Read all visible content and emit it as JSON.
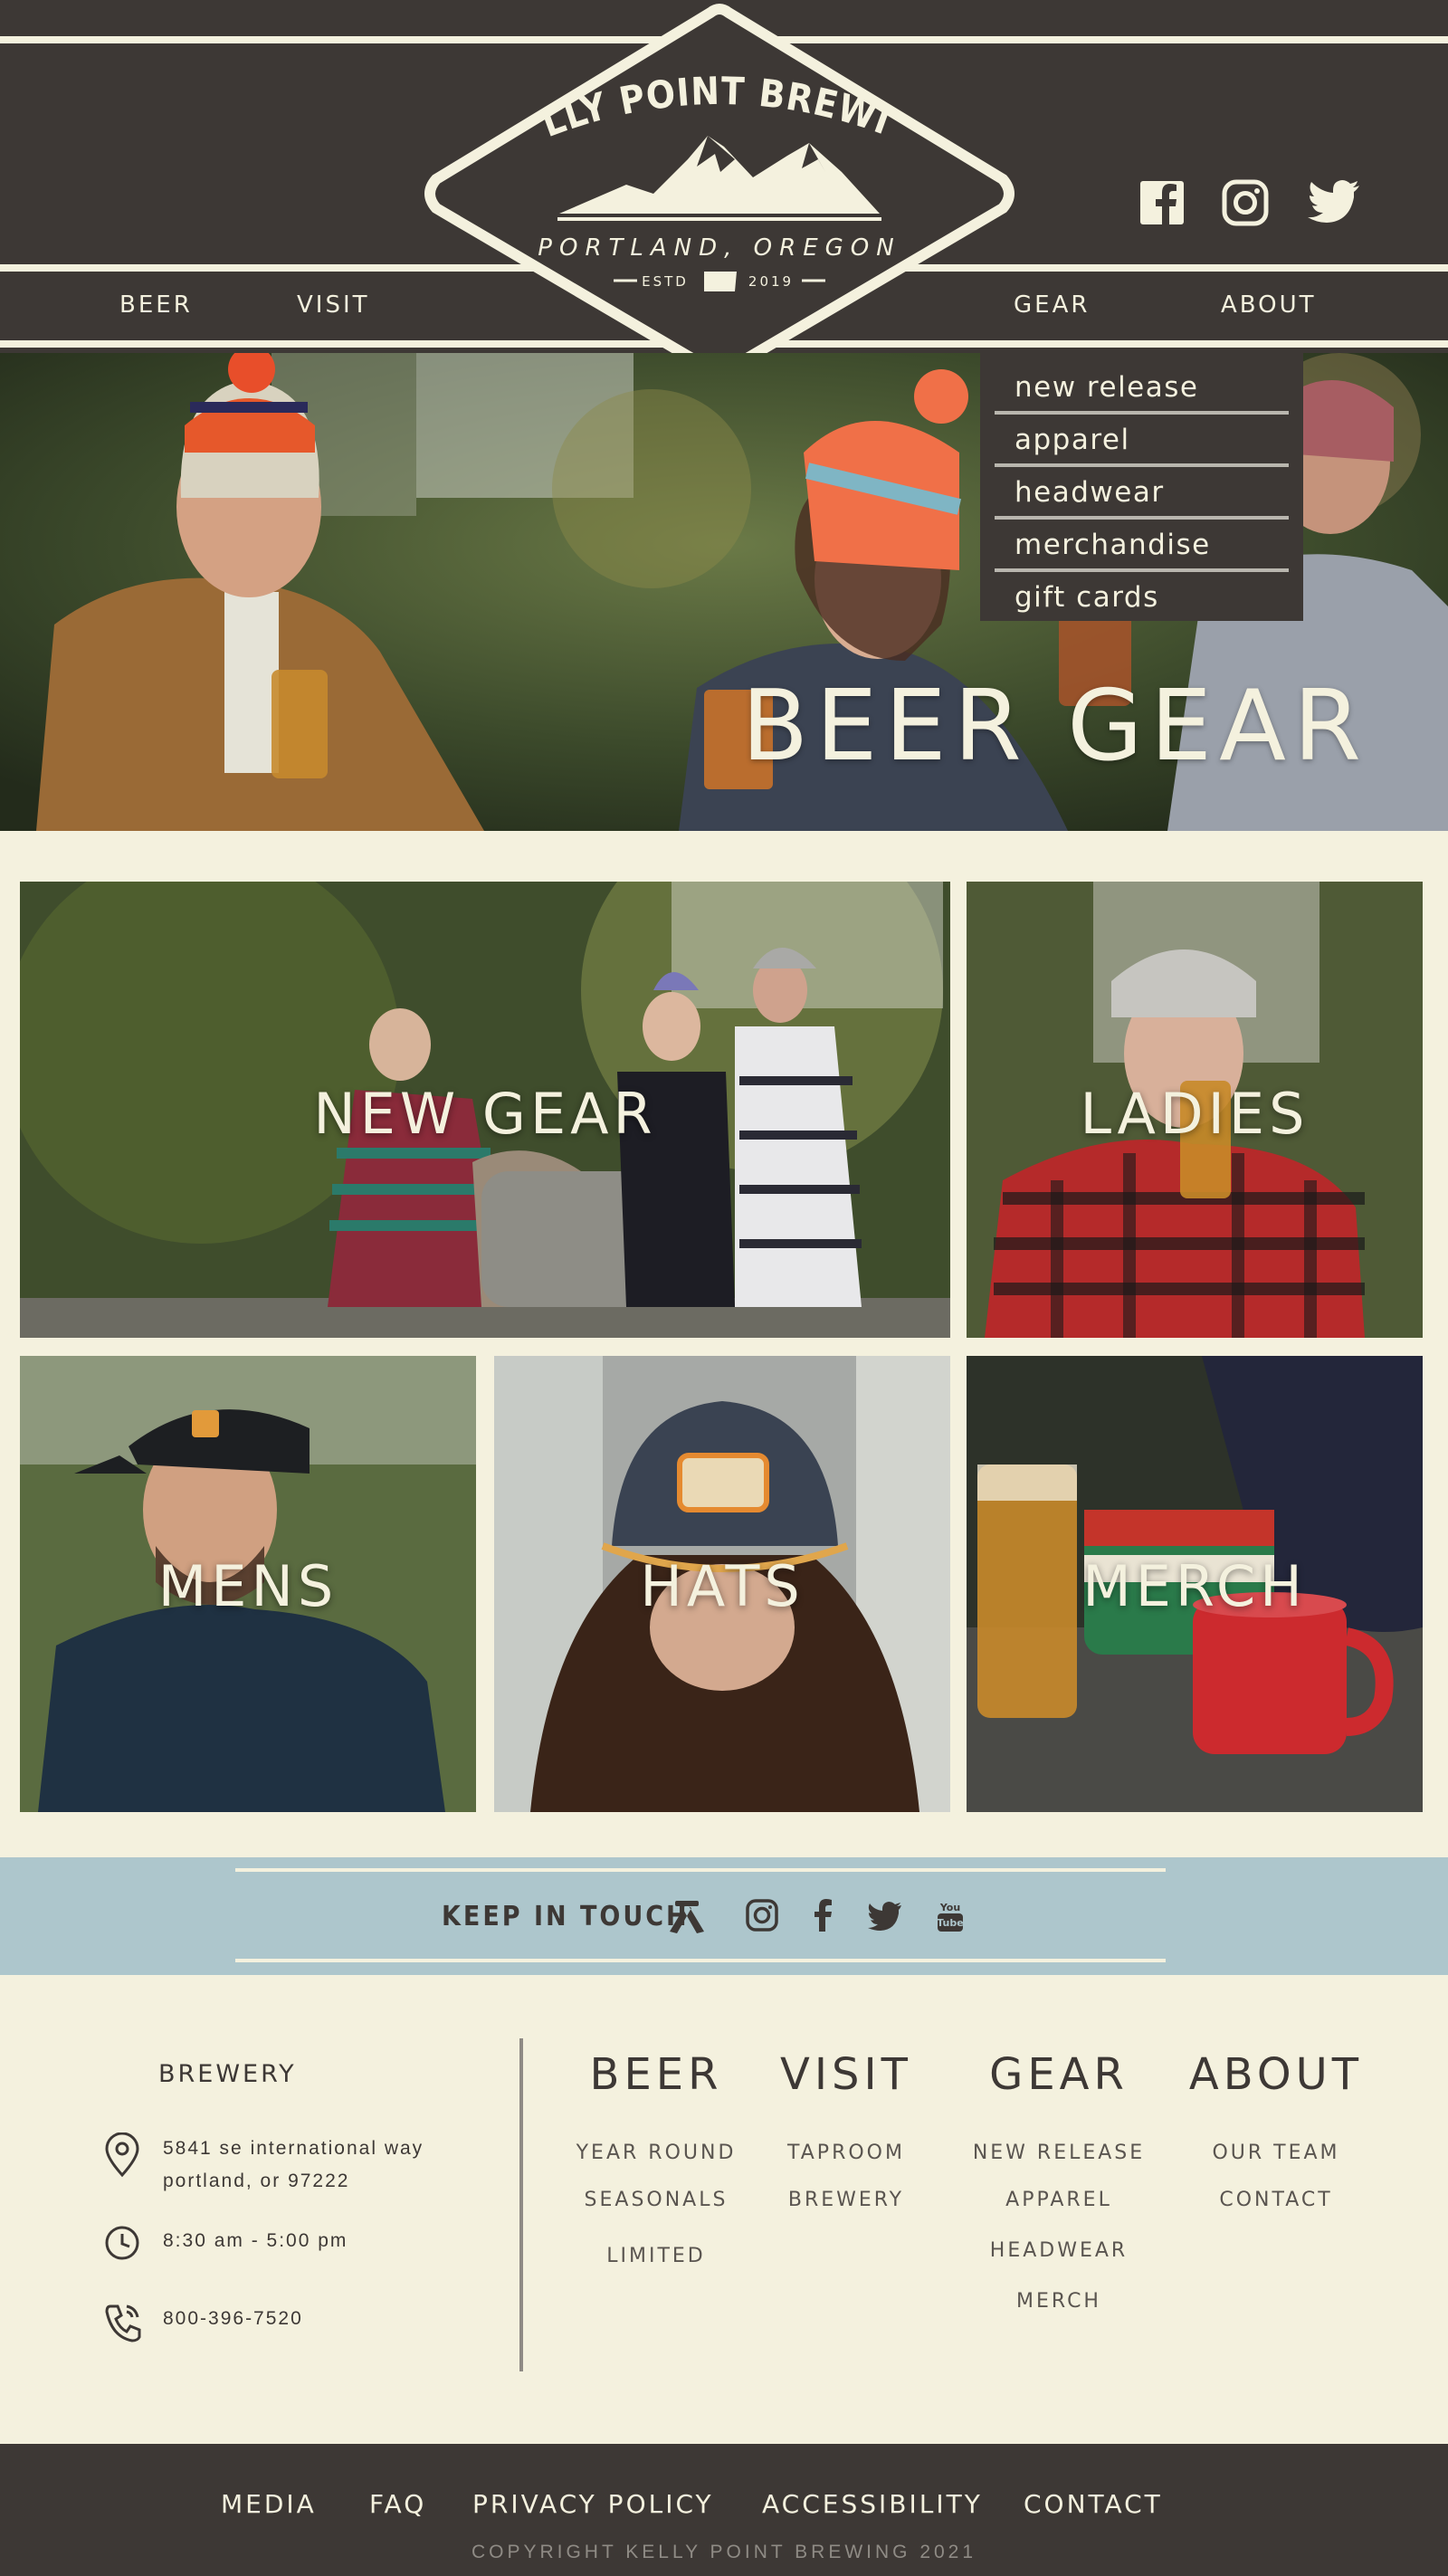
{
  "brand": {
    "name": "KELLY POINT BREWING",
    "location": "PORTLAND, OREGON",
    "estd_label": "ESTD",
    "estd_year": "2019"
  },
  "nav": {
    "beer": "BEER",
    "visit": "VISIT",
    "gear": "GEAR",
    "about": "ABOUT"
  },
  "social_icons": [
    "facebook-icon",
    "instagram-icon",
    "twitter-icon"
  ],
  "gear_dropdown": [
    "new release",
    "apparel",
    "headwear",
    "merchandise",
    "gift cards"
  ],
  "hero": {
    "title": "BEER GEAR"
  },
  "categories": {
    "new_gear": "NEW GEAR",
    "ladies": "LADIES",
    "mens": "MENS",
    "hats": "HATS",
    "merch": "MERCH"
  },
  "keep_in_touch": {
    "title": "KEEP IN TOUCH",
    "icons": [
      "untappd-icon",
      "instagram-icon",
      "facebook-icon",
      "twitter-icon",
      "youtube-icon"
    ]
  },
  "footer": {
    "brewery_title": "BREWERY",
    "address_line1": "5841 se international way",
    "address_line2": "portland, or 97222",
    "hours": "8:30 am - 5:00 pm",
    "phone": "800-396-7520",
    "columns": {
      "beer": {
        "head": "BEER",
        "links": [
          "YEAR ROUND",
          "SEASONALS",
          "LIMITED"
        ]
      },
      "visit": {
        "head": "VISIT",
        "links": [
          "TAPROOM",
          "BREWERY"
        ]
      },
      "gear": {
        "head": "GEAR",
        "links": [
          "NEW RELEASE",
          "APPAREL",
          "HEADWEAR",
          "MERCH"
        ]
      },
      "about": {
        "head": "ABOUT",
        "links": [
          "OUR TEAM",
          "CONTACT"
        ]
      }
    }
  },
  "bottom_bar": {
    "media": "MEDIA",
    "faq": "FAQ",
    "privacy": "PRIVACY POLICY",
    "accessibility": "ACCESSIBILITY",
    "contact": "CONTACT",
    "copyright": "COPYRIGHT KELLY POINT BREWING 2021"
  },
  "colors": {
    "dark": "#3d3835",
    "cream": "#f4f1de",
    "blue": "#adc6cc"
  }
}
